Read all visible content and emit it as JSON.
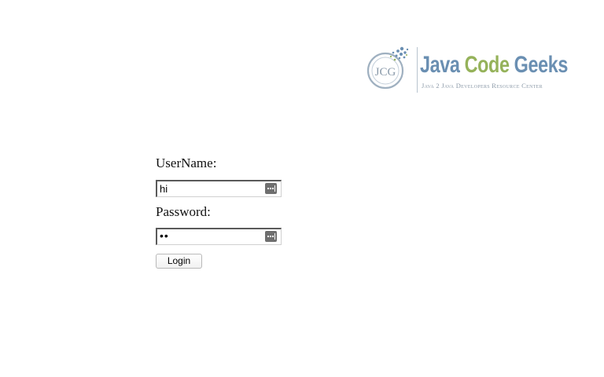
{
  "logo": {
    "monogram": "JCG",
    "name_part1": "Java",
    "name_part2": "Code",
    "name_part3": "Geeks",
    "tagline": "Java 2 Java Developers Resource Center",
    "colors": {
      "blue": "#6a8fb2",
      "green": "#95b25a"
    }
  },
  "form": {
    "username_label": "UserName:",
    "username_value": "hi",
    "password_label": "Password:",
    "password_value": "••",
    "login_label": "Login",
    "field_icon": "password-manager-key-icon"
  }
}
